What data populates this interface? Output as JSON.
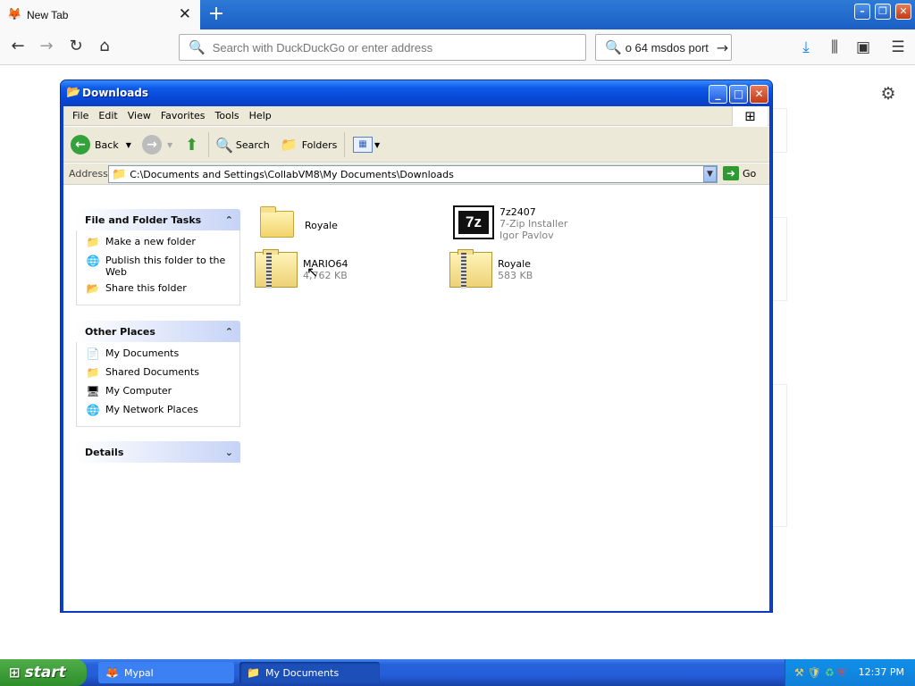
{
  "browser": {
    "tab_title": "New Tab",
    "tab_close": "✕",
    "new_tab": "+",
    "url_placeholder": "Search with DuckDuckGo or enter address",
    "search_value": "o 64 msdos port",
    "window_buttons": {
      "minimize": "–",
      "restore": "❐",
      "close": "✕"
    }
  },
  "explorer": {
    "title": "Downloads",
    "menu": [
      "File",
      "Edit",
      "View",
      "Favorites",
      "Tools",
      "Help"
    ],
    "toolbar": {
      "back": "Back",
      "search": "Search",
      "folders": "Folders"
    },
    "address_label": "Address",
    "address_path": "C:\\Documents and Settings\\CollabVM8\\My Documents\\Downloads",
    "go_label": "Go",
    "panels": {
      "file_tasks": {
        "title": "File and Folder Tasks",
        "items": [
          "Make a new folder",
          "Publish this folder to the Web",
          "Share this folder"
        ]
      },
      "other_places": {
        "title": "Other Places",
        "items": [
          "My Documents",
          "Shared Documents",
          "My Computer",
          "My Network Places"
        ]
      },
      "details": {
        "title": "Details"
      }
    },
    "files": [
      {
        "name": "Royale",
        "type": "folder",
        "line2": "",
        "line3": ""
      },
      {
        "name": "7z2407",
        "type": "installer",
        "line2": "7-Zip Installer",
        "line3": "Igor Pavlov"
      },
      {
        "name": "MARIO64",
        "type": "zip",
        "line2": "4,762 KB",
        "line3": ""
      },
      {
        "name": "Royale",
        "type": "zip",
        "line2": "583 KB",
        "line3": ""
      }
    ]
  },
  "taskbar": {
    "start_label": "start",
    "buttons": [
      {
        "label": "Mypal",
        "active": false
      },
      {
        "label": "My Documents",
        "active": true
      }
    ],
    "clock": "12:37 PM"
  },
  "colors": {
    "xp_blue": "#0a3fd0",
    "taskbar_blue": "#245edb",
    "start_green": "#3a9b35",
    "firefox_blue": "#1b5fc6"
  }
}
